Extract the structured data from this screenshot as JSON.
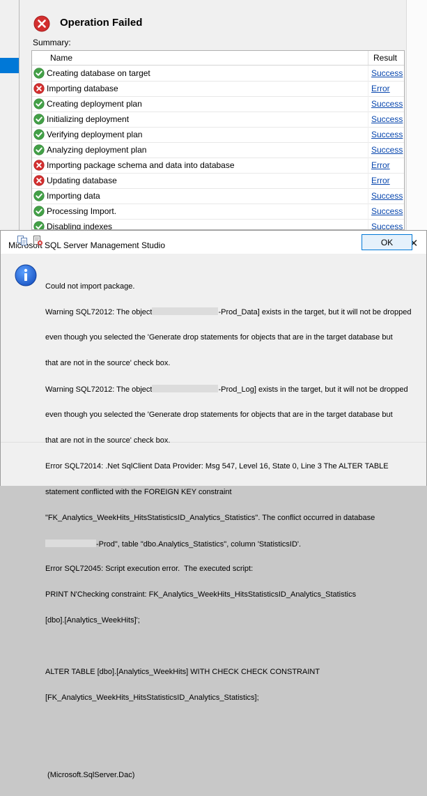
{
  "operation": {
    "title": "Operation Failed",
    "summary_label": "Summary:",
    "columns": {
      "name": "Name",
      "result": "Result"
    },
    "rows": [
      {
        "status": "success",
        "name": "Creating database on target",
        "result": "Success"
      },
      {
        "status": "error",
        "name": "Importing database",
        "result": "Error"
      },
      {
        "status": "success",
        "name": "Creating deployment plan",
        "result": "Success"
      },
      {
        "status": "success",
        "name": "Initializing deployment",
        "result": "Success"
      },
      {
        "status": "success",
        "name": "Verifying deployment plan",
        "result": "Success"
      },
      {
        "status": "success",
        "name": "Analyzing deployment plan",
        "result": "Success"
      },
      {
        "status": "error",
        "name": "Importing package schema and data into database",
        "result": "Error"
      },
      {
        "status": "error",
        "name": "Updating database",
        "result": "Error"
      },
      {
        "status": "success",
        "name": "Importing data",
        "result": "Success"
      },
      {
        "status": "success",
        "name": "Processing Import.",
        "result": "Success"
      },
      {
        "status": "success",
        "name": "Disabling indexes",
        "result": "Success"
      }
    ]
  },
  "dialog": {
    "title": "Microsoft SQL Server Management Studio",
    "close_glyph": "✕",
    "message": {
      "l1": "Could not import package.",
      "l2a": "Warning SQL72012: The object",
      "l2b": "-Prod_Data] exists in the target, but it will not be dropped",
      "l3": "even though you selected the 'Generate drop statements for objects that are in the target database but",
      "l4": "that are not in the source' check box.",
      "l5a": "Warning SQL72012: The object",
      "l5b": "-Prod_Log] exists in the target, but it will not be dropped",
      "l6": "even though you selected the 'Generate drop statements for objects that are in the target database but",
      "l7": "that are not in the source' check box.",
      "l8": "Error SQL72014: .Net SqlClient Data Provider: Msg 547, Level 16, State 0, Line 3 The ALTER TABLE",
      "l9": "statement conflicted with the FOREIGN KEY constraint",
      "l10": "\"FK_Analytics_WeekHits_HitsStatisticsID_Analytics_Statistics\". The conflict occurred in database",
      "l11b": "-Prod\", table \"dbo.Analytics_Statistics\", column 'StatisticsID'.",
      "l12": "Error SQL72045: Script execution error.  The executed script:",
      "l13": "PRINT N'Checking constraint: FK_Analytics_WeekHits_HitsStatisticsID_Analytics_Statistics",
      "l14": "[dbo].[Analytics_WeekHits]';",
      "l16": "ALTER TABLE [dbo].[Analytics_WeekHits] WITH CHECK CHECK CONSTRAINT",
      "l17": "[FK_Analytics_WeekHits_HitsStatisticsID_Analytics_Statistics];",
      "l20": " (Microsoft.SqlServer.Dac)"
    },
    "ok_label": "OK"
  },
  "colors": {
    "success": "#43a047",
    "error": "#d32f2f",
    "link": "#0645ad",
    "accent": "#0078d7"
  },
  "icons": {
    "fail": "error-circle-icon",
    "info": "info-icon",
    "copy": "copy-icon",
    "details": "details-icon"
  }
}
